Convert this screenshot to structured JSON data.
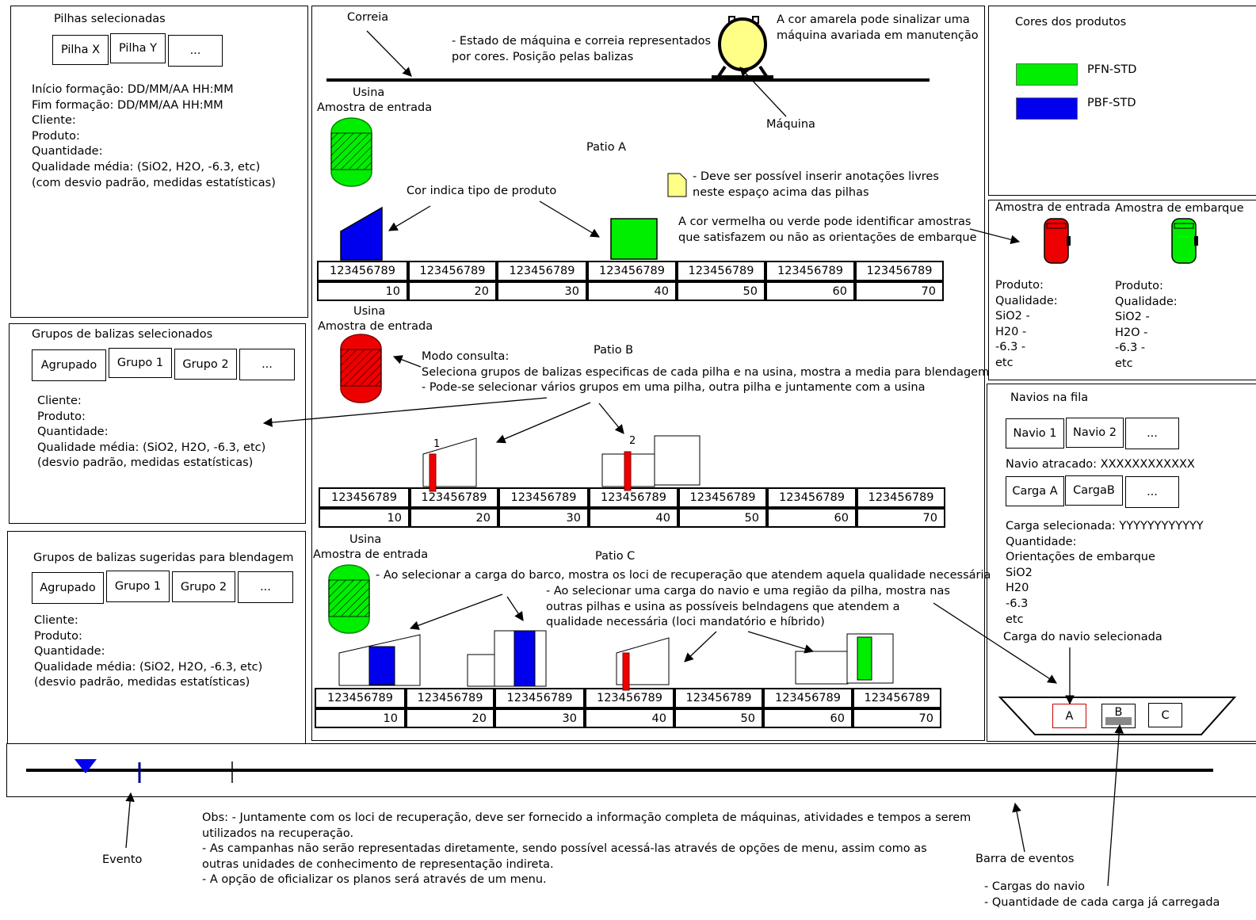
{
  "colors": {
    "pfn": "#00ee00",
    "pbf": "#0000ee",
    "red": "#ee0000",
    "yellow": "#ffff88",
    "note": "#ffff88"
  },
  "pilhas_panel": {
    "title": "Pilhas selecionadas",
    "tabs": [
      "Pilha X",
      "Pilha Y",
      "..."
    ],
    "lines": [
      "Início formação: DD/MM/AA  HH:MM",
      "Fim formação: DD/MM/AA HH:MM",
      "Cliente:",
      "Produto:",
      "Quantidade:",
      "Qualidade média: (SiO2, H2O, -6.3, etc)",
      "(com desvio padrão, medidas estatísticas)"
    ]
  },
  "grupos_panel": {
    "title": "Grupos de balizas selecionados",
    "tabs": [
      "Agrupado",
      "Grupo 1",
      "Grupo 2",
      "..."
    ],
    "lines": [
      "Cliente:",
      "Produto:",
      "Quantidade:",
      "Qualidade média: (SiO2, H2O, -6.3, etc)",
      "(desvio padrão, medidas estatísticas)"
    ]
  },
  "sugeridas_panel": {
    "title": "Grupos de balizas sugeridas para blendagem",
    "tabs": [
      "Agrupado",
      "Grupo 1",
      "Grupo 2",
      "..."
    ],
    "lines": [
      "Cliente:",
      "Produto:",
      "Quantidade:",
      "Qualidade média: (SiO2, H2O, -6.3, etc)",
      "(desvio padrão, medidas estatísticas)"
    ]
  },
  "center": {
    "correia": "Correia",
    "estado_note": [
      "- Estado de máquina e correia representados",
      "por cores. Posição pelas balizas"
    ],
    "amarela_note": [
      "A cor amarela pode sinalizar uma",
      "máquina avariada em manutenção"
    ],
    "maquina": "Máquina",
    "usina": "Usina",
    "amostra_entrada": "Amostra de entrada",
    "patio_a": "Patio A",
    "patio_b": "Patio B",
    "patio_c": "Patio C",
    "cor_indica": "Cor indica tipo de produto",
    "anotacoes": [
      "- Deve ser possível inserir anotações livres",
      "neste espaço acima das pilhas"
    ],
    "vermelha_note": [
      "A cor vermelha ou verde pode identificar amostras",
      "que satisfazem ou não as orientações de embarque"
    ],
    "modo_consulta": [
      "Modo consulta:",
      "Seleciona grupos de balizas especificas de cada pilha e na usina, mostra a media para blendagem",
      "- Pode-se selecionar vários grupos em uma pilha, outra pilha e juntamente com a usina"
    ],
    "loci_note1": "- Ao selecionar a carga do barco, mostra os loci de recuperação que atendem aquela qualidade necessária",
    "loci_note2": [
      "- Ao selecionar uma carga do navio e uma região da pilha, mostra nas",
      "outras pilhas e usina as possíveis belndagens que atendem a",
      "qualidade necessária (loci mandatório e híbrido)"
    ],
    "group_labels": [
      "1",
      "2"
    ],
    "baliza_code": "123456789",
    "baliza_positions": [
      "10",
      "20",
      "30",
      "40",
      "50",
      "60",
      "70"
    ]
  },
  "cores_panel": {
    "title": "Cores dos produtos",
    "items": [
      {
        "label": "PFN-STD",
        "color": "#00ee00"
      },
      {
        "label": "PBF-STD",
        "color": "#0000ee"
      }
    ]
  },
  "amostras_panel": {
    "entrada_title": "Amostra de entrada",
    "embarque_title": "Amostra de embarque",
    "entrada_lines": [
      "Produto:",
      "Qualidade:",
      "SiO2 -",
      "H20 -",
      "-6.3 -",
      "etc"
    ],
    "embarque_lines": [
      "Produto:",
      "Qualidade:",
      "SiO2 -",
      "H2O -",
      "-6.3 -",
      "etc"
    ]
  },
  "navios_panel": {
    "title": "Navios na fila",
    "navio_tabs": [
      "Navio 1",
      "Navio 2",
      "..."
    ],
    "atracado": "Navio atracado: XXXXXXXXXXXX",
    "carga_tabs": [
      "Carga A",
      "CargaB",
      "..."
    ],
    "lines": [
      "Carga selecionada: YYYYYYYYYYYY",
      "Quantidade:",
      "Orientações de embarque",
      "SiO2",
      "H20",
      "-6.3",
      "etc"
    ],
    "carga_navio_sel": "Carga do navio selecionada",
    "ship_holds": [
      "A",
      "B",
      "C"
    ],
    "hold_b_loaded": 0.45
  },
  "bottom": {
    "evento": "Evento",
    "barra_eventos": "Barra de eventos",
    "obs_lines": [
      "Obs: - Juntamente com os loci de recuperação, deve ser fornecido a informação completa de máquinas, atividades e tempos a serem",
      "utilizados na recuperação.",
      "- As campanhas não serão representadas diretamente, sendo possível acessá-las através de opções de menu, assim como as",
      "outras unidades de conhecimento de representação indireta.",
      "- A opção de oficializar os planos será através de um menu."
    ],
    "cargas_lines": [
      "- Cargas do navio",
      "- Quantidade de cada carga já carregada"
    ]
  }
}
